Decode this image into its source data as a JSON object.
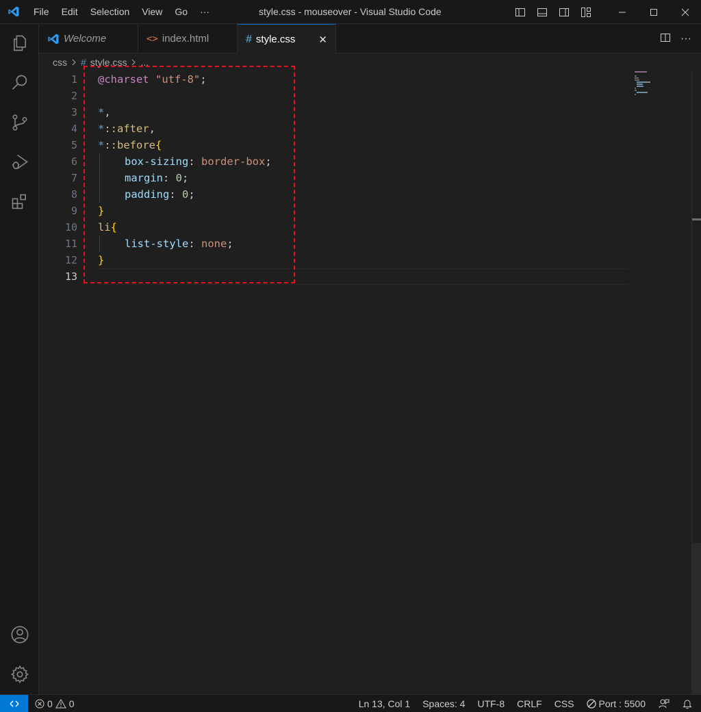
{
  "app": {
    "title": "style.css - mouseover - Visual Studio Code",
    "menu": [
      "File",
      "Edit",
      "Selection",
      "View",
      "Go",
      "···"
    ]
  },
  "tabs": [
    {
      "label": "Welcome",
      "icon": "vscode-icon"
    },
    {
      "label": "index.html",
      "icon": "html-icon"
    },
    {
      "label": "style.css",
      "icon": "css-hash-icon",
      "close": "✕"
    }
  ],
  "breadcrumb": {
    "folder": "css",
    "file": "style.css",
    "more": "..."
  },
  "editor": {
    "line_numbers": [
      "1",
      "2",
      "3",
      "4",
      "5",
      "6",
      "7",
      "8",
      "9",
      "10",
      "11",
      "12",
      "13"
    ],
    "current_line": "13",
    "lines": {
      "l1a": "@charset",
      "l1b": " \"utf-8\"",
      "l1c": ";",
      "l3a": "*",
      "l3b": ",",
      "l4a": "*",
      "l4b": "::after",
      "l4c": ",",
      "l5a": "*",
      "l5b": "::before",
      "l5c": "{",
      "l6a": "box-sizing",
      "l6b": ": ",
      "l6c": "border-box",
      "l6d": ";",
      "l7a": "margin",
      "l7b": ": ",
      "l7c": "0",
      "l7d": ";",
      "l8a": "padding",
      "l8b": ": ",
      "l8c": "0",
      "l8d": ";",
      "l9a": "}",
      "l10a": "li",
      "l10b": "{",
      "l11a": "list-style",
      "l11b": ": ",
      "l11c": "none",
      "l11d": ";",
      "l12a": "}"
    }
  },
  "status": {
    "errors": "0",
    "warnings": "0",
    "position": "Ln 13, Col 1",
    "spaces": "Spaces: 4",
    "encoding": "UTF-8",
    "eol": "CRLF",
    "language": "CSS",
    "port": "Port : 5500"
  },
  "colors": {
    "accent": "#0078d4",
    "highlight_box": "#e81123"
  }
}
